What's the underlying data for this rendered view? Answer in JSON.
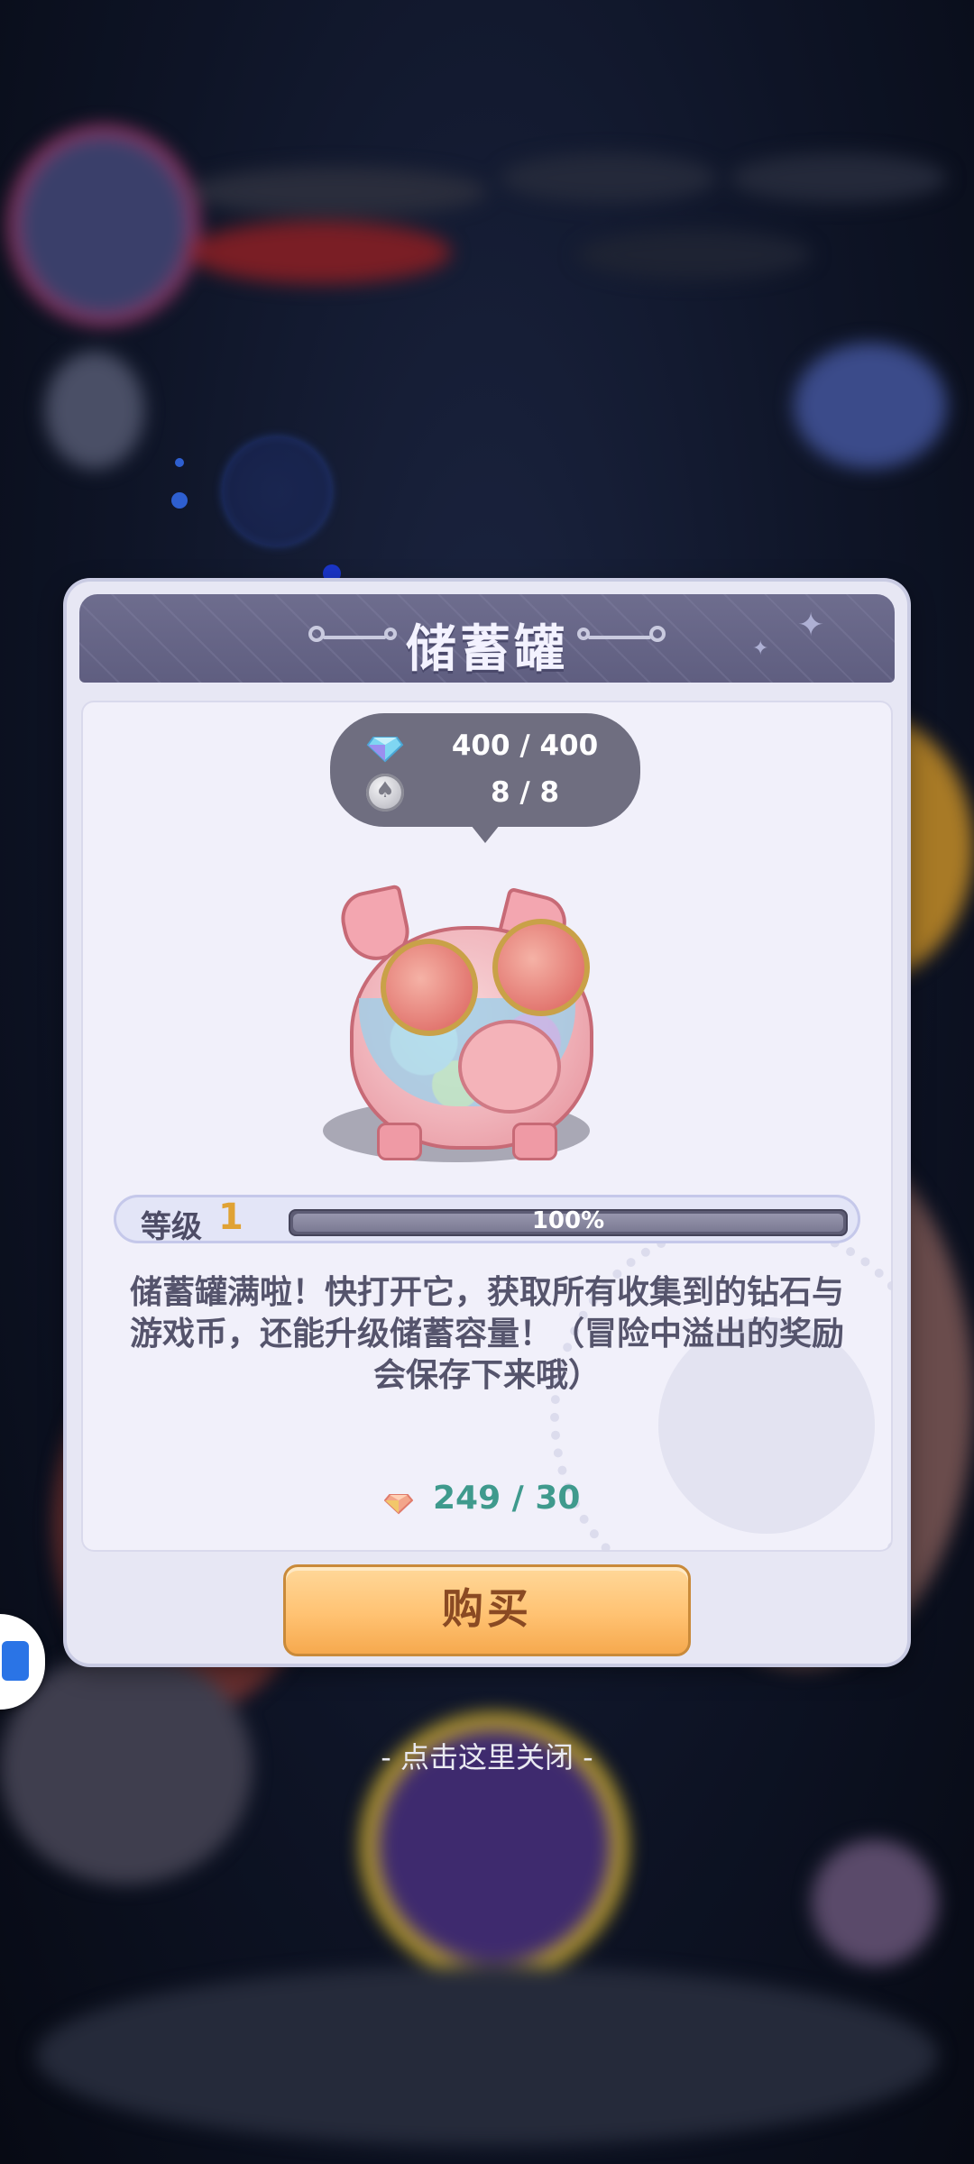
{
  "modal": {
    "title": "储蓄罐",
    "resources": {
      "diamond_value": "400 / 400",
      "coin_value": "8 / 8"
    },
    "level": {
      "label": "等级",
      "number": "1",
      "progress_text": "100%",
      "progress_fraction": 1.0
    },
    "description": "储蓄罐满啦！快打开它，获取所有收集到的钻石与游戏币，还能升级储蓄容量！（冒险中溢出的奖励会保存下来哦）",
    "price": "249 / 30",
    "buy_label": "购买"
  },
  "close_hint": "- 点击这里关闭 -",
  "icons": {
    "diamond": "diamond-icon",
    "coin": "coin-icon",
    "price_gem": "gem-icon",
    "piggy": "piggy-bank-illustration"
  },
  "colors": {
    "accent_gold": "#e0a234",
    "price_teal": "#3f9a8d",
    "buy_button": "#ffc272"
  }
}
